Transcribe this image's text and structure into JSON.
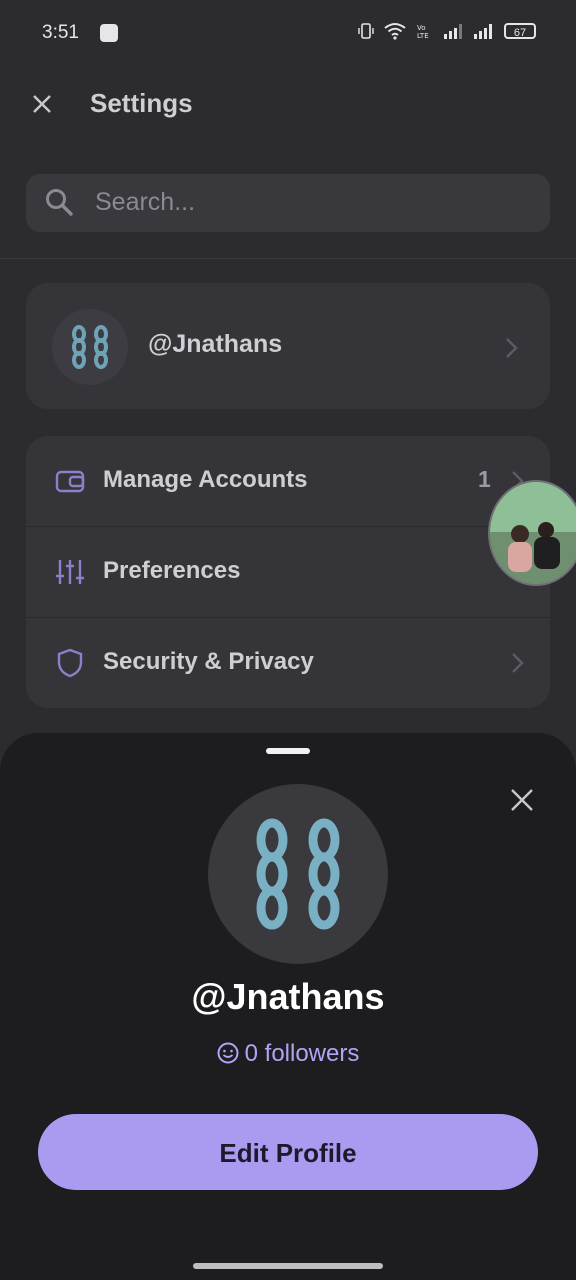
{
  "status_bar": {
    "time": "3:51",
    "battery": "67"
  },
  "header": {
    "title": "Settings"
  },
  "search": {
    "placeholder": "Search..."
  },
  "profile": {
    "handle": "@Jnathans"
  },
  "menu": {
    "items": [
      {
        "label": "Manage Accounts",
        "icon": "wallet-icon",
        "badge": "1"
      },
      {
        "label": "Preferences",
        "icon": "sliders-icon"
      },
      {
        "label": "Security & Privacy",
        "icon": "shield-icon"
      }
    ]
  },
  "sheet": {
    "handle": "@Jnathans",
    "followers": "0 followers",
    "edit_button": "Edit Profile"
  },
  "colors": {
    "accent": "#ab9bf0",
    "followers_text": "#b3a3f5",
    "chain": "#7ab0c4"
  }
}
